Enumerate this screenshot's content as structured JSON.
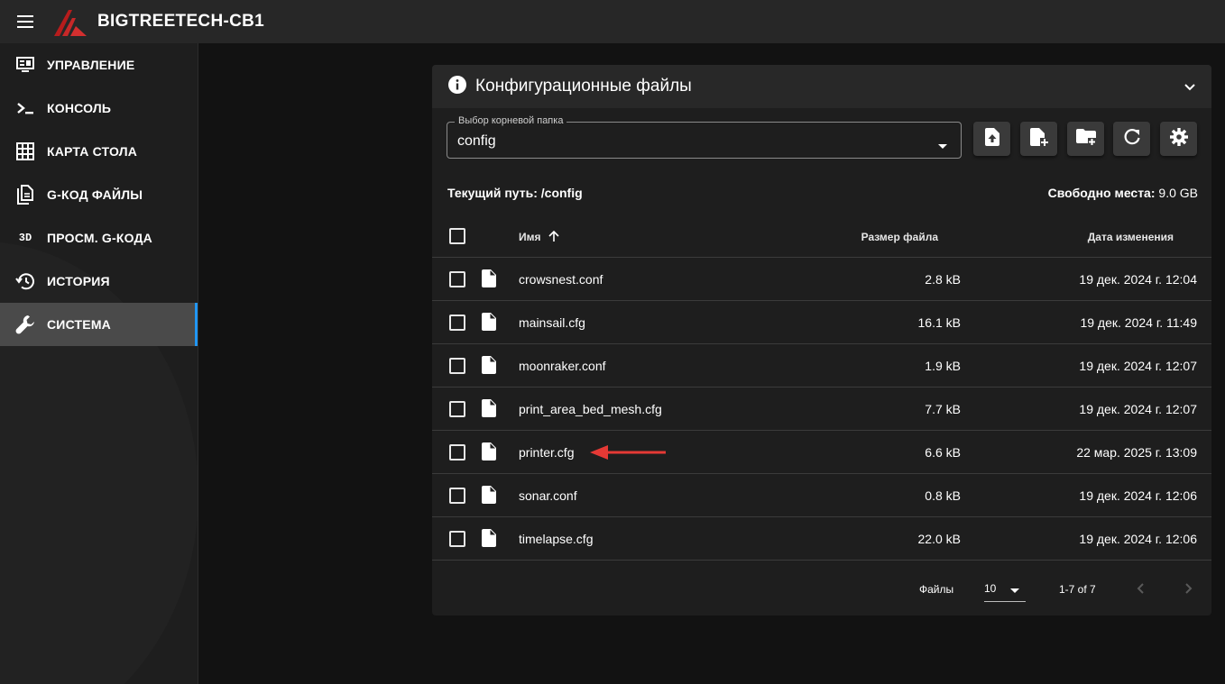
{
  "app": {
    "title": "BIGTREETECH-CB1",
    "brand_color": "#c62828"
  },
  "sidebar": {
    "items": [
      {
        "label": "УПРАВЛЕНИЕ",
        "icon": "monitor-dashboard-icon",
        "active": false
      },
      {
        "label": "КОНСОЛЬ",
        "icon": "console-icon",
        "active": false
      },
      {
        "label": "КАРТА СТОЛА",
        "icon": "grid-icon",
        "active": false
      },
      {
        "label": "G-КОД ФАЙЛЫ",
        "icon": "file-document-icon",
        "active": false
      },
      {
        "label": "ПРОСМ. G-КОДА",
        "icon": "3d-icon",
        "active": false
      },
      {
        "label": "ИСТОРИЯ",
        "icon": "history-icon",
        "active": false
      },
      {
        "label": "СИСТЕМА",
        "icon": "wrench-icon",
        "active": true
      }
    ],
    "icon_3d_text": "3D",
    "active_accent": "#2196f3"
  },
  "panel": {
    "title": "Конфигурационные файлы",
    "root_select": {
      "label": "Выбор корневой папка",
      "value": "config"
    },
    "toolbar_buttons": [
      "upload-file-icon",
      "create-file-icon",
      "create-folder-icon",
      "refresh-icon",
      "settings-gear-icon"
    ],
    "path_label": "Текущий путь: /config",
    "free_space_label": "Свободно места:",
    "free_space_value": "9.0 GB"
  },
  "table": {
    "headers": {
      "name": "Имя",
      "size": "Размер файла",
      "date": "Дата изменения"
    },
    "sort": {
      "column": "name",
      "direction": "ascending"
    },
    "rows": [
      {
        "name": "crowsnest.conf",
        "size": "2.8 kB",
        "date": "19 дек. 2024 г. 12:04"
      },
      {
        "name": "mainsail.cfg",
        "size": "16.1 kB",
        "date": "19 дек. 2024 г. 11:49"
      },
      {
        "name": "moonraker.conf",
        "size": "1.9 kB",
        "date": "19 дек. 2024 г. 12:07"
      },
      {
        "name": "print_area_bed_mesh.cfg",
        "size": "7.7 kB",
        "date": "19 дек. 2024 г. 12:07"
      },
      {
        "name": "printer.cfg",
        "size": "6.6 kB",
        "date": "22 мар. 2025 г. 13:09"
      },
      {
        "name": "sonar.conf",
        "size": "0.8 kB",
        "date": "19 дек. 2024 г. 12:06"
      },
      {
        "name": "timelapse.cfg",
        "size": "22.0 kB",
        "date": "19 дек. 2024 г. 12:06"
      }
    ]
  },
  "footer": {
    "files_label": "Файлы",
    "per_page": "10",
    "range": "1-7 of 7"
  },
  "annotation": {
    "arrow_color": "#e53935",
    "points_to": "printer.cfg"
  }
}
